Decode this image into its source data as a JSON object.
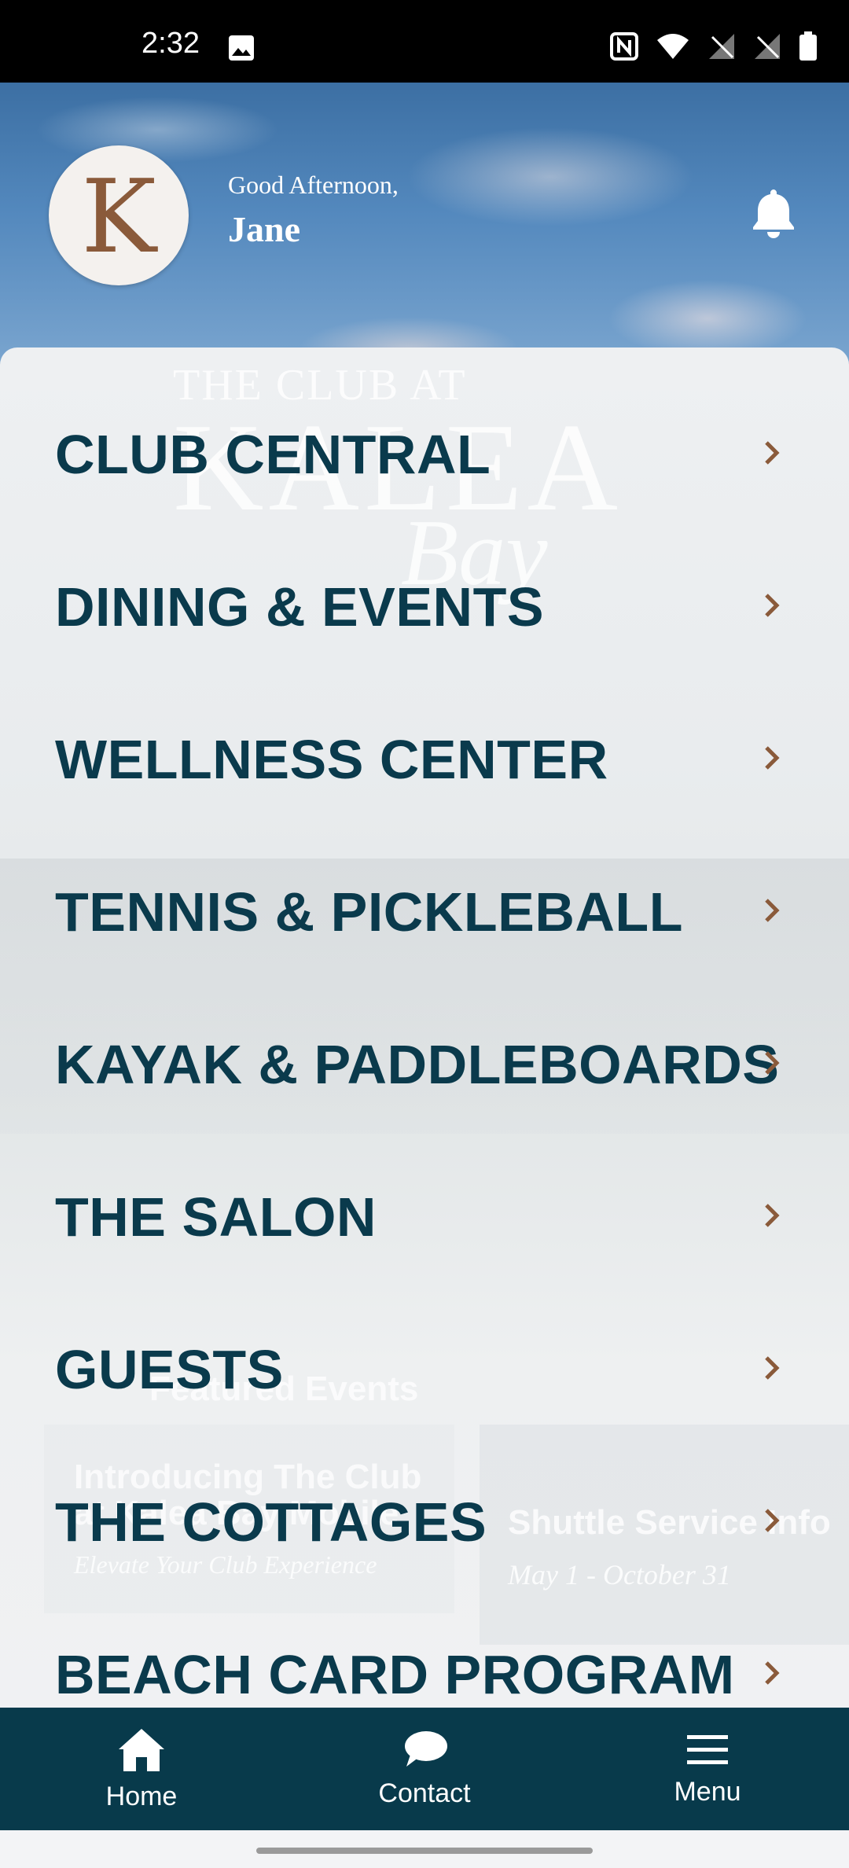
{
  "status_bar": {
    "time": "2:32"
  },
  "header": {
    "avatar_letter": "K",
    "greeting": "Good Afternoon,",
    "user_name": "Jane"
  },
  "background": {
    "brand_line1": "THE CLUB AT",
    "brand_line2": "KALEA",
    "brand_line3": "Bay",
    "featured_events_title": "Featured Events",
    "card1_title": "Introducing The Club at Kalea Bay Mobile",
    "card1_subtitle": "Elevate Your Club Experience",
    "card2_title": "Shuttle Service Info",
    "card2_subtitle": "May 1 - October 31"
  },
  "menu": {
    "items": [
      {
        "label": "CLUB CENTRAL"
      },
      {
        "label": "DINING & EVENTS"
      },
      {
        "label": "WELLNESS CENTER"
      },
      {
        "label": "TENNIS & PICKLEBALL"
      },
      {
        "label": "KAYAK & PADDLEBOARDS"
      },
      {
        "label": "THE SALON"
      },
      {
        "label": "GUESTS"
      },
      {
        "label": "THE COTTAGES"
      },
      {
        "label": "BEACH CARD PROGRAM"
      }
    ]
  },
  "bottom_nav": {
    "home": "Home",
    "contact": "Contact",
    "menu": "Menu"
  },
  "colors": {
    "primary": "#083a4b",
    "menu_text": "#0a3a4c",
    "chevron": "#8a5a3a"
  }
}
